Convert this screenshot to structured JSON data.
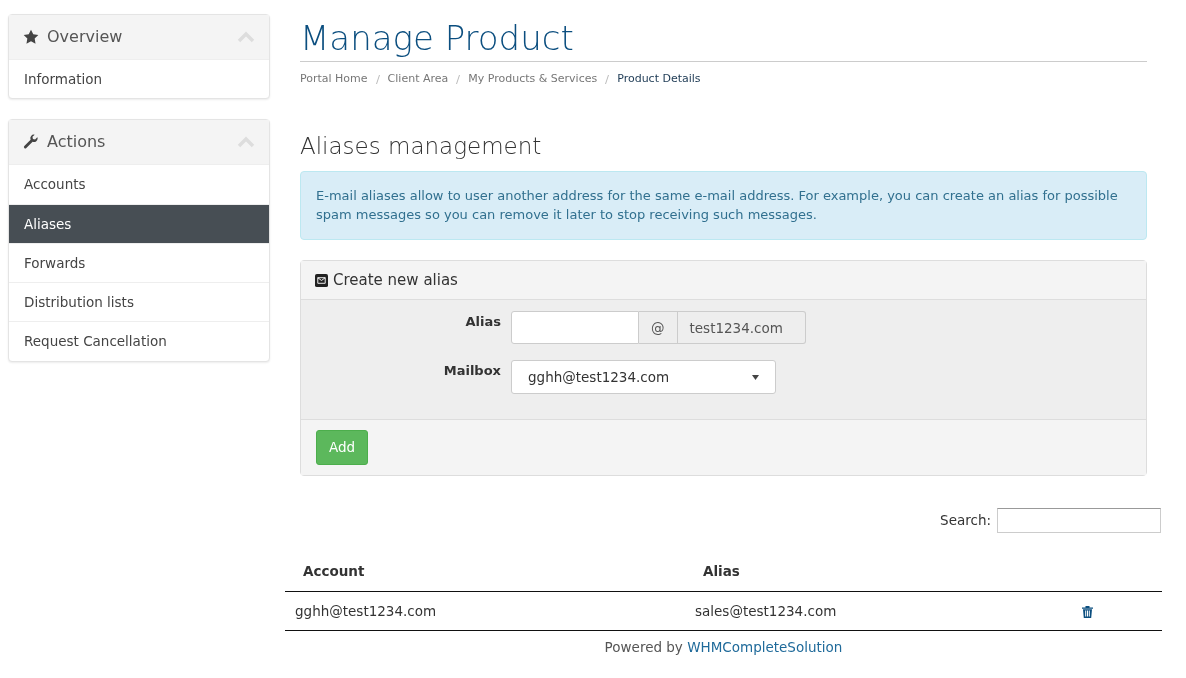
{
  "sidebar": [
    {
      "title": "Overview",
      "expanded": true,
      "items": [
        {
          "label": "Information",
          "selected": false
        }
      ]
    },
    {
      "title": "Actions",
      "expanded": true,
      "items": [
        {
          "label": "Accounts",
          "selected": false
        },
        {
          "label": "Aliases",
          "selected": true
        },
        {
          "label": "Forwards",
          "selected": false
        },
        {
          "label": "Distribution lists",
          "selected": false
        },
        {
          "label": "Request Cancellation",
          "selected": false
        }
      ]
    }
  ],
  "page_title": "Manage Product",
  "breadcrumb": [
    {
      "label": "Portal Home",
      "selected": false
    },
    {
      "label": "Client Area",
      "selected": false
    },
    {
      "label": "My Products & Services",
      "selected": false
    },
    {
      "label": "Product Details",
      "selected": true
    }
  ],
  "section_title": "Aliases management",
  "info": "E-mail aliases allow to user another address for the same e-mail address. For example, you can create an alias for possible spam messages so you can remove it later to stop receiving such messages.",
  "form": {
    "title": "Create new alias",
    "alias_label": "Alias",
    "at": "@",
    "domain": "test1234.com",
    "mailbox_label": "Mailbox",
    "mailbox_value": "gghh@test1234.com",
    "button": "Add"
  },
  "search_label": "Search:",
  "table": {
    "columns": [
      "Account",
      "Alias"
    ],
    "rows": [
      {
        "account": "gghh@test1234.com",
        "alias": "sales@test1234.com"
      }
    ]
  },
  "footer": {
    "text": "Powered by",
    "link": "WHMCompleteSolution"
  }
}
